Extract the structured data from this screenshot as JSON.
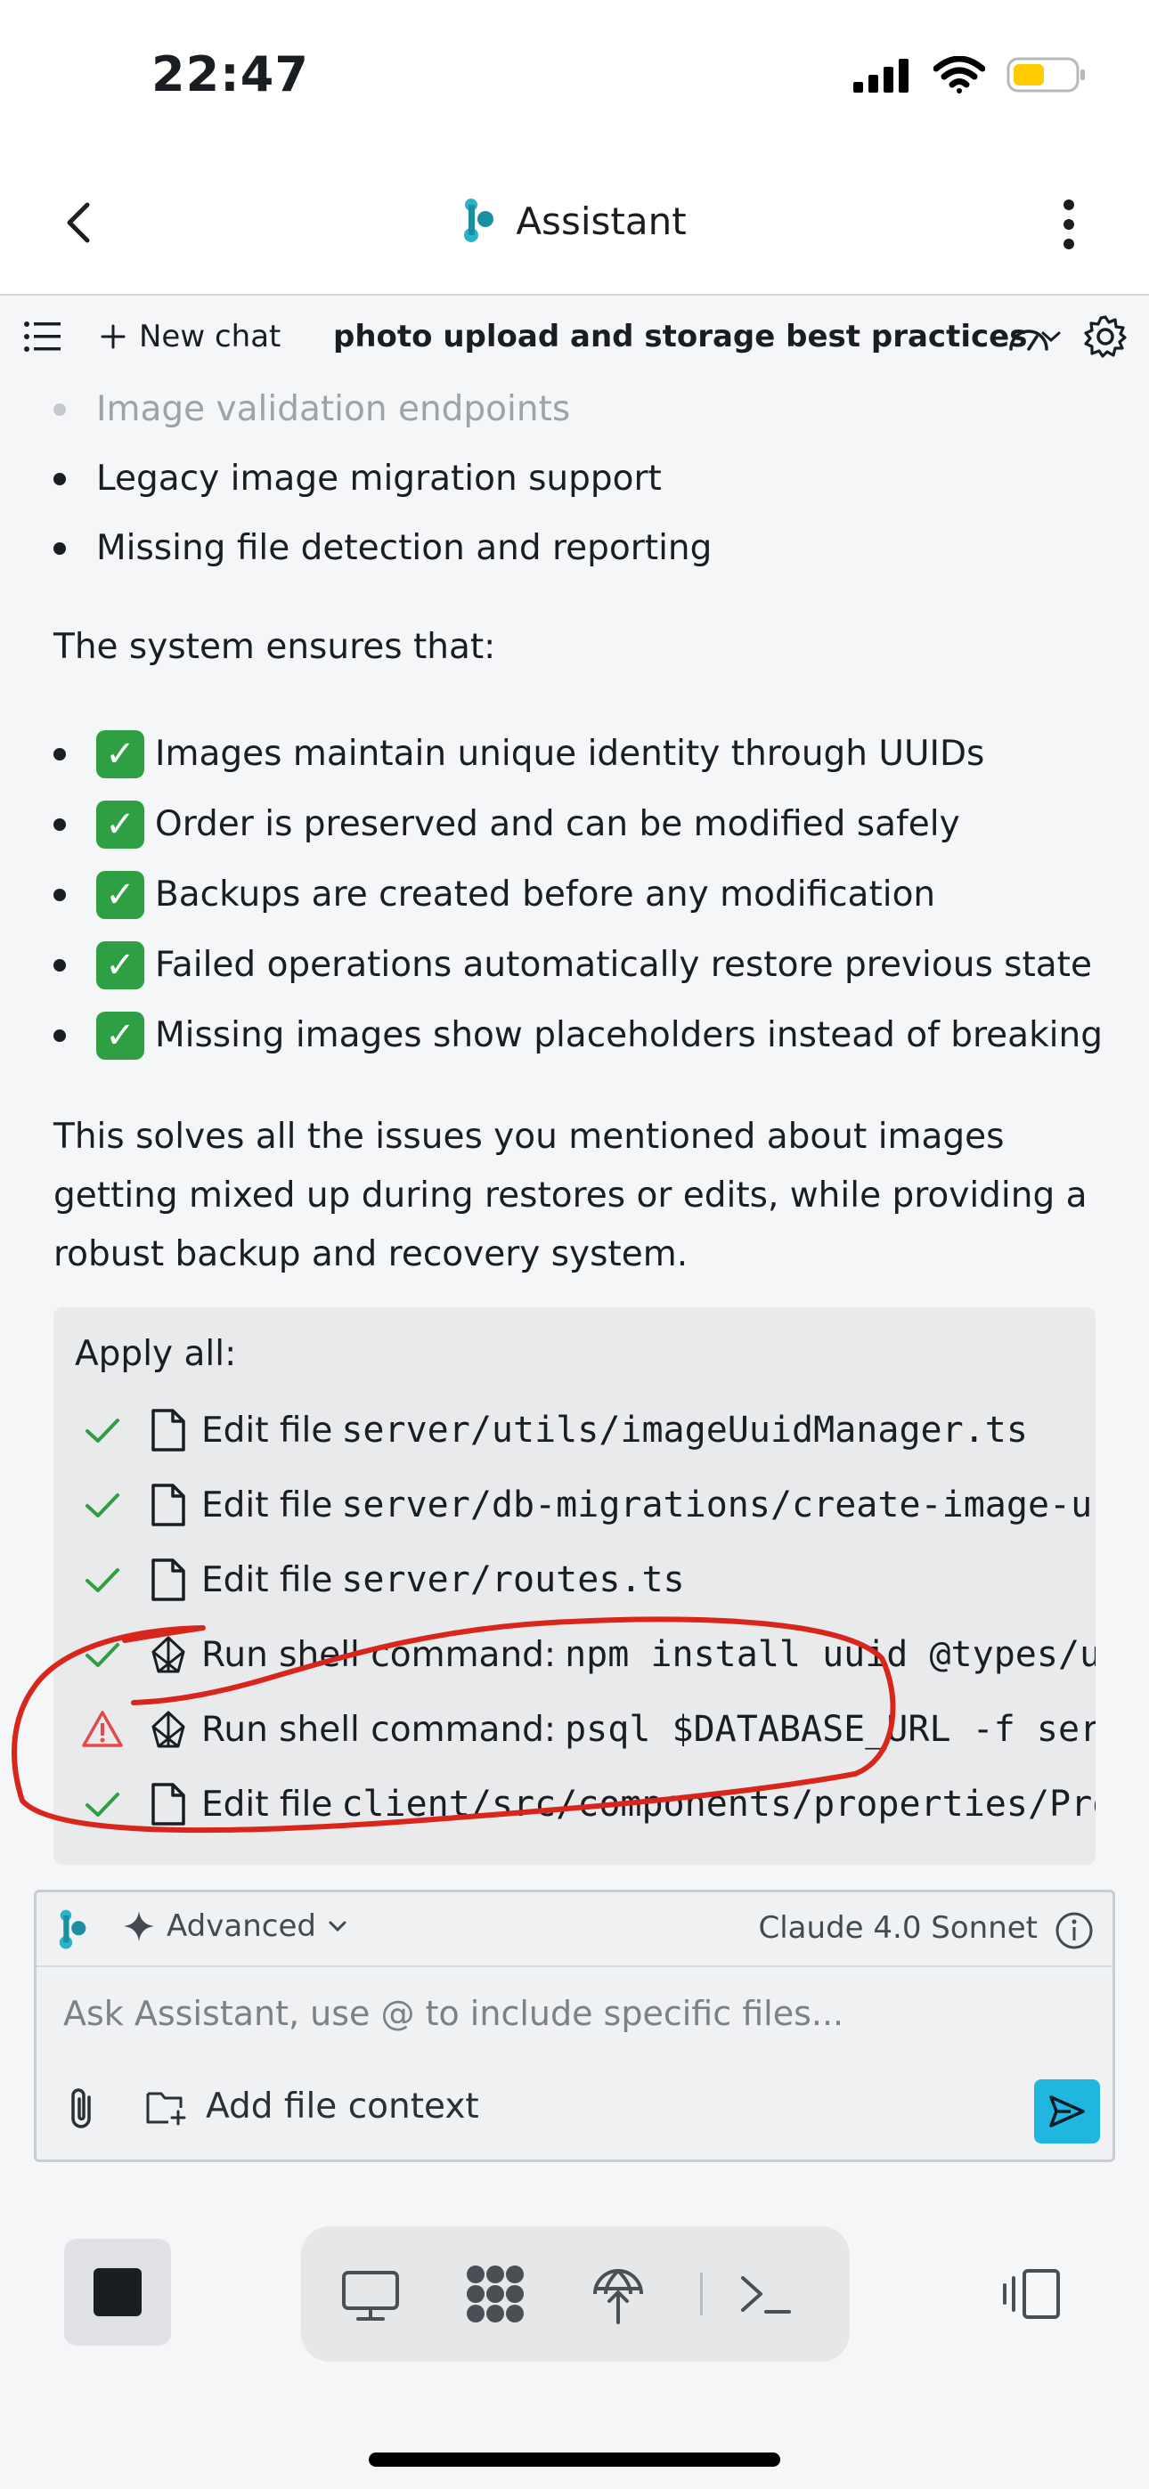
{
  "status_bar": {
    "time": "22:47"
  },
  "header": {
    "title": "Assistant"
  },
  "toolbar": {
    "new_chat_label": "New chat",
    "chat_title": "photo upload and storage best practices"
  },
  "message": {
    "bullets_top": [
      "Image validation endpoints",
      "Legacy image migration support",
      "Missing file detection and reporting"
    ],
    "system_intro": "The system ensures that:",
    "ensures": [
      "Images maintain unique identity through UUIDs",
      "Order is preserved and can be modified safely",
      "Backups are created before any modification",
      "Failed operations automatically restore previous state",
      "Missing images show placeholders instead of breaking"
    ],
    "summary": "This solves all the issues you mentioned about images getting mixed up during restores or edits, while providing a robust backup and recovery system."
  },
  "apply_all": {
    "title": "Apply all:",
    "actions": [
      {
        "status": "done",
        "kind": "file",
        "label": "Edit file",
        "target": "server/utils/imageUuidManager.ts"
      },
      {
        "status": "done",
        "kind": "file",
        "label": "Edit file",
        "target": "server/db-migrations/create-image-uuid-table.sql"
      },
      {
        "status": "done",
        "kind": "file",
        "label": "Edit file",
        "target": "server/routes.ts"
      },
      {
        "status": "done",
        "kind": "shell",
        "label": "Run shell command:",
        "target": "npm install uuid @types/uuid"
      },
      {
        "status": "warning",
        "kind": "shell",
        "label": "Run shell command:",
        "target": "psql $DATABASE_URL -f server/db-migrations/create-image-uuid-table.sql"
      },
      {
        "status": "done",
        "kind": "file",
        "label": "Edit file",
        "target": "client/src/components/properties/PropertyForm.tsx"
      }
    ],
    "annotation_color": "#d9261c"
  },
  "composer": {
    "mode_label": "Advanced",
    "model_label": "Claude 4.0 Sonnet",
    "placeholder": "Ask Assistant, use @ to include specific files...",
    "add_context_label": "Add file context",
    "send_color": "#1fb6e0"
  },
  "colors": {
    "check_green": "#2ea043",
    "warning_red": "#e5484d",
    "brand_teal": "#1a8fa0"
  }
}
